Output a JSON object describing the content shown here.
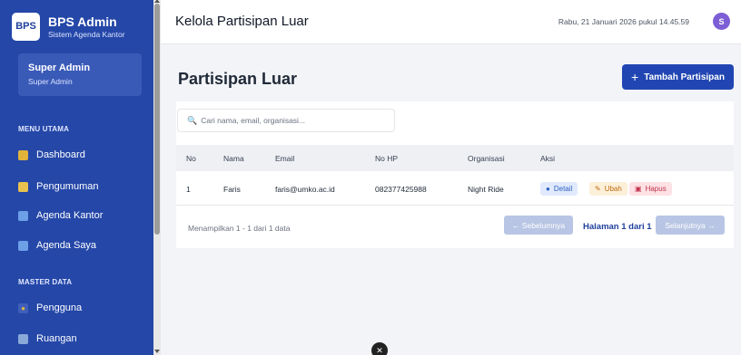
{
  "brand": {
    "logo": "BPS",
    "title": "BPS Admin",
    "subtitle": "Sistem Agenda Kantor"
  },
  "user": {
    "name": "Super Admin",
    "role": "Super Admin"
  },
  "sidebar": {
    "section_main": "MENU UTAMA",
    "section_master": "MASTER DATA",
    "items": [
      {
        "label": "Dashboard",
        "icon": "dashboard-icon",
        "color": "#e0b33a"
      },
      {
        "label": "Pengumuman",
        "icon": "announcement-icon",
        "color": "#e9c14e"
      },
      {
        "label": "Agenda Kantor",
        "icon": "calendar-icon",
        "color": "#6ea0e8"
      },
      {
        "label": "Agenda Saya",
        "icon": "calendar-icon",
        "color": "#6ea0e8"
      },
      {
        "label": "Pengguna",
        "icon": "users-icon",
        "color": "#e0b33a"
      },
      {
        "label": "Ruangan",
        "icon": "building-icon",
        "color": "#8aa9d8"
      }
    ]
  },
  "header": {
    "title": "Kelola Partisipan Luar",
    "datetime": "Rabu, 21 Januari 2026 pukul 14.45.59",
    "avatar_initial": "S"
  },
  "main": {
    "title": "Partisipan Luar",
    "add_button": "Tambah Partisipan",
    "search_placeholder": "Cari nama, email, organisasi...",
    "columns": [
      "No",
      "Nama",
      "Email",
      "No HP",
      "Organisasi",
      "Aksi"
    ],
    "rows": [
      {
        "no": "1",
        "nama": "Faris",
        "email": "faris@umko.ac.id",
        "hp": "082377425988",
        "organisasi": "Night Ride"
      }
    ],
    "actions": {
      "detail": "Detail",
      "ubah": "Ubah",
      "hapus": "Hapus"
    },
    "footer_info": "Menampilkan 1 - 1 dari 1 data",
    "prev": "← Sebelumnya",
    "page_label": "Halaman 1 dari 1",
    "next": "Selanjutnya →"
  }
}
